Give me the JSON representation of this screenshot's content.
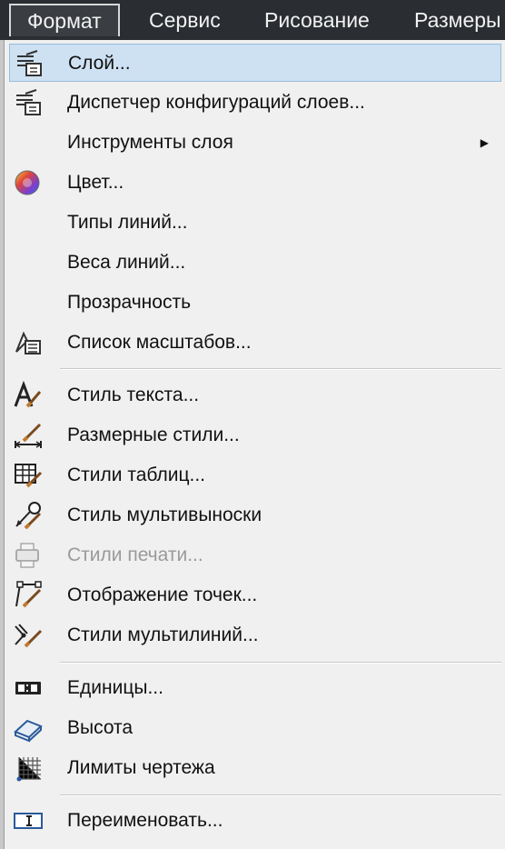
{
  "menubar": {
    "items": [
      {
        "label": "Формат"
      },
      {
        "label": "Сервис"
      },
      {
        "label": "Рисование"
      },
      {
        "label": "Размеры"
      }
    ]
  },
  "menu": {
    "items": [
      {
        "label": "Слой...",
        "icon": "layer-icon"
      },
      {
        "label": "Диспетчер конфигураций слоев...",
        "icon": "layer-states-icon"
      },
      {
        "label": "Инструменты слоя",
        "icon": "",
        "submenu_arrow": "▶"
      },
      {
        "label": "Цвет...",
        "icon": "color-wheel-icon"
      },
      {
        "label": "Типы линий...",
        "icon": ""
      },
      {
        "label": "Веса линий...",
        "icon": ""
      },
      {
        "label": "Прозрачность",
        "icon": ""
      },
      {
        "label": "Список масштабов...",
        "icon": "scale-list-icon"
      },
      {
        "label": "Стиль текста...",
        "icon": "text-style-icon"
      },
      {
        "label": "Размерные стили...",
        "icon": "dimension-style-icon"
      },
      {
        "label": "Стили таблиц...",
        "icon": "table-style-icon"
      },
      {
        "label": "Стиль мультивыноски",
        "icon": "multileader-style-icon"
      },
      {
        "label": "Стили печати...",
        "icon": "plot-style-icon"
      },
      {
        "label": "Отображение точек...",
        "icon": "point-style-icon"
      },
      {
        "label": "Стили мультилиний...",
        "icon": "multiline-style-icon"
      },
      {
        "label": "Единицы...",
        "icon": "units-icon"
      },
      {
        "label": "Высота",
        "icon": "thickness-icon"
      },
      {
        "label": "Лимиты чертежа",
        "icon": "drawing-limits-icon"
      },
      {
        "label": "Переименовать...",
        "icon": "rename-icon"
      }
    ]
  }
}
